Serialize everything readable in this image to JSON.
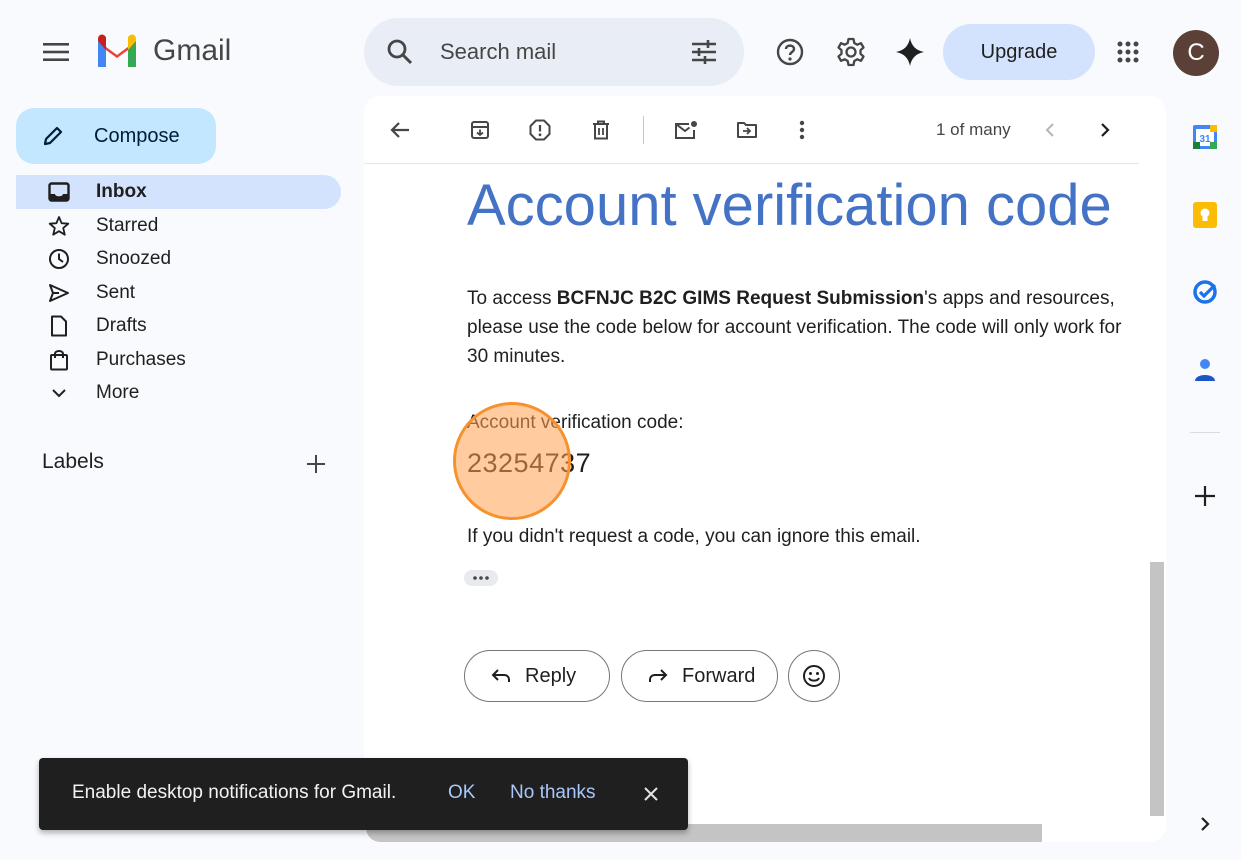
{
  "header": {
    "brand": "Gmail",
    "search_placeholder": "Search mail",
    "upgrade_label": "Upgrade",
    "avatar_initial": "C"
  },
  "sidebar": {
    "compose_label": "Compose",
    "items": [
      {
        "label": "Inbox",
        "icon": "inbox-icon",
        "active": true
      },
      {
        "label": "Starred",
        "icon": "star-icon"
      },
      {
        "label": "Snoozed",
        "icon": "clock-icon"
      },
      {
        "label": "Sent",
        "icon": "send-icon"
      },
      {
        "label": "Drafts",
        "icon": "draft-icon"
      },
      {
        "label": "Purchases",
        "icon": "shopping-bag-icon"
      },
      {
        "label": "More",
        "icon": "chevron-down-icon"
      }
    ],
    "labels_title": "Labels"
  },
  "toolbar": {
    "pager": "1 of many"
  },
  "email": {
    "subject": "Account verification code",
    "para_prefix": "To access ",
    "para_bold": "BCFNJC B2C GIMS Request Submission",
    "para_suffix": "'s apps and resources, please use the code below for account verification. The code will only work for 30 minutes.",
    "code_label": "Account verification code:",
    "code_value": "23254737",
    "ignore_text": "If you didn't request a code, you can ignore this email.",
    "reply_label": "Reply",
    "forward_label": "Forward"
  },
  "rail": {
    "calendar_day": "31"
  },
  "snackbar": {
    "message": "Enable desktop notifications for Gmail.",
    "ok_label": "OK",
    "no_label": "No thanks"
  },
  "colors": {
    "accent": "#0b57d0",
    "compose_bg": "#c2e7ff",
    "active_nav": "#d3e3fd",
    "subject": "#4472c4",
    "click_highlight": "#f5922f"
  }
}
